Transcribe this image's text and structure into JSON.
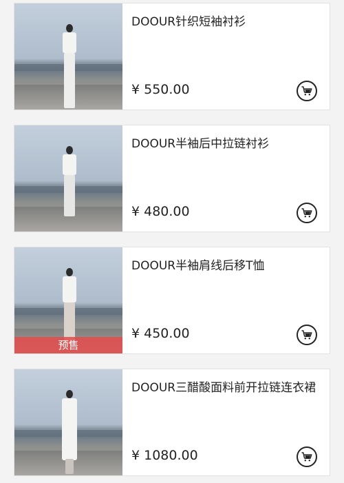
{
  "products": [
    {
      "title": "DOOUR针织短袖衬衫",
      "price": "¥ 550.00",
      "badge": ""
    },
    {
      "title": "DOOUR半袖后中拉链衬衫",
      "price": "¥ 480.00",
      "badge": ""
    },
    {
      "title": "DOOUR半袖肩线后移T恤",
      "price": "¥ 450.00",
      "badge": "预售"
    },
    {
      "title": "DOOUR三醋酸面料前开拉链连衣裙",
      "price": "¥ 1080.00",
      "badge": ""
    }
  ],
  "icons": {
    "cart": "shopping-cart-icon"
  },
  "colors": {
    "presale_badge": "#e24c4c",
    "text": "#222222",
    "card_bg": "#ffffff",
    "page_bg": "#f3f3f3"
  }
}
